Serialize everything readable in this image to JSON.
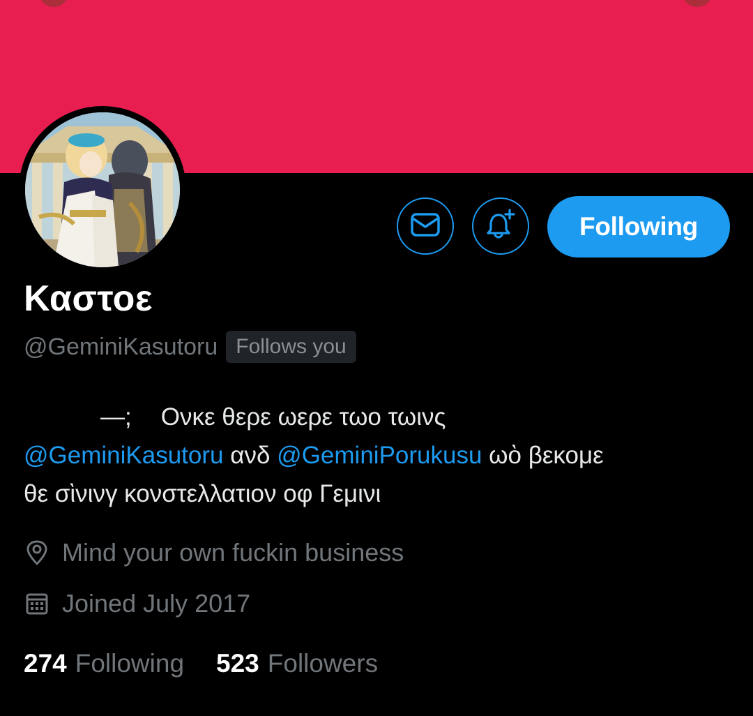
{
  "profile": {
    "display_name": "Καστοε",
    "handle": "@GeminiKasutoru",
    "follows_you": "Follows you",
    "follow_button": "Following",
    "bio": {
      "prefix": "—;",
      "line1_text": "Ονκε θερε ωερε τωο τωινς",
      "mention1": "@GeminiKasutoru",
      "conj": "ανδ",
      "mention2": "@GeminiPorukusu",
      "line2_tail": "ωὸ βεκομε",
      "line3": "θε σὶνινγ κονστελλατιον οφ Γεμινι"
    },
    "location": "Mind your own fuckin business",
    "joined": "Joined July 2017",
    "following_count": "274",
    "following_label": "Following",
    "followers_count": "523",
    "followers_label": "Followers"
  },
  "icons": {
    "message": "mail-icon",
    "notifications": "bell-plus-icon",
    "location": "location-pin-icon",
    "calendar": "calendar-icon"
  },
  "colors": {
    "banner": "#e81e51",
    "accent": "#1d9bf0",
    "background": "#000000",
    "secondary_text": "#71767b"
  }
}
